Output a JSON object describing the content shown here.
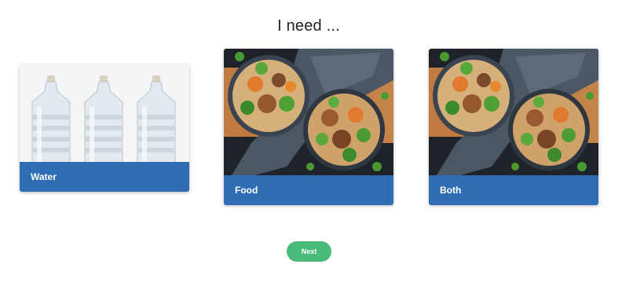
{
  "header": {
    "title": "I need ..."
  },
  "options": [
    {
      "label": "Water",
      "image": "water-bottles-photo"
    },
    {
      "label": "Food",
      "image": "food-bowls-photo"
    },
    {
      "label": "Both",
      "image": "food-bowls-photo"
    }
  ],
  "next_button": {
    "label": "Next"
  },
  "colors": {
    "label_bar": "#2f6db5",
    "next_button": "#48bb78"
  }
}
